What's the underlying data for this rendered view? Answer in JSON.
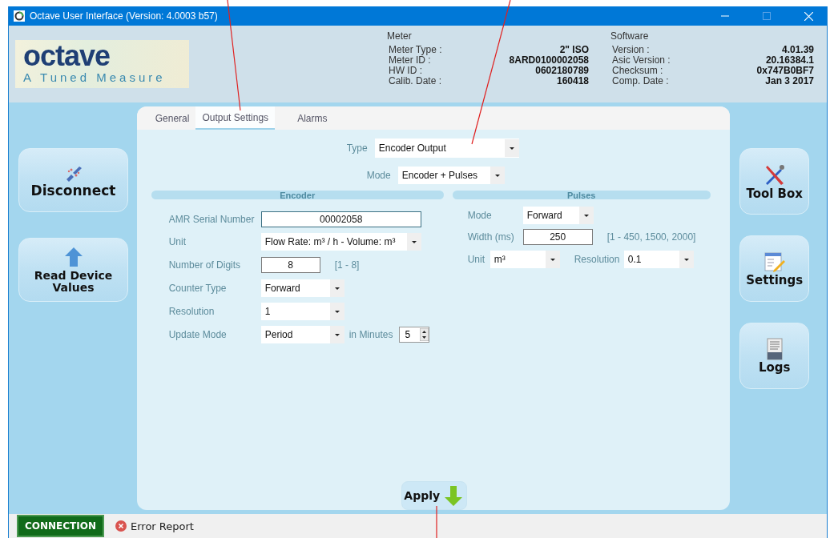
{
  "window": {
    "title": "Octave User Interface (Version: 4.0003 b57)"
  },
  "header": {
    "logo": {
      "name": "octave",
      "tagline": "A Tuned Measure"
    },
    "meter": {
      "heading": "Meter",
      "rows": [
        {
          "label": "Meter Type :",
          "value": "2\" ISO"
        },
        {
          "label": "Meter ID :",
          "value": "8ARD0100002058"
        },
        {
          "label": "HW ID :",
          "value": "0602180789"
        },
        {
          "label": "Calib. Date :",
          "value": "160418"
        }
      ]
    },
    "software": {
      "heading": "Software",
      "rows": [
        {
          "label": "Version :",
          "value": "4.01.39"
        },
        {
          "label": "Asic Version :",
          "value": "20.16384.1"
        },
        {
          "label": "Checksum :",
          "value": "0x747B0BF7"
        },
        {
          "label": "Comp. Date :",
          "value": "Jan 3 2017"
        }
      ]
    }
  },
  "left_buttons": [
    {
      "kind": "disconnect",
      "label": "Disconnect"
    },
    {
      "kind": "read",
      "label": "Read Device Values"
    }
  ],
  "right_buttons": [
    {
      "kind": "toolbox",
      "label": "Tool Box"
    },
    {
      "kind": "settings",
      "label": "Settings"
    },
    {
      "kind": "logs",
      "label": "Logs"
    }
  ],
  "tabs": [
    {
      "label": "General",
      "selected": false
    },
    {
      "label": "Output Settings",
      "selected": true
    },
    {
      "label": "Alarms",
      "selected": false
    }
  ],
  "output": {
    "type": {
      "label": "Type",
      "value": "Encoder Output"
    },
    "mode": {
      "label": "Mode",
      "value": "Encoder + Pulses"
    }
  },
  "encoder": {
    "heading": "Encoder",
    "rows": [
      {
        "fields": [
          {
            "kind": "text",
            "label": "AMR Serial Number",
            "value": "00002058"
          }
        ]
      },
      {
        "fields": [
          {
            "kind": "select",
            "label": "Unit",
            "value": "Flow Rate: m³ / h - Volume: m³"
          }
        ]
      },
      {
        "fields": [
          {
            "kind": "text",
            "label": "Number of Digits",
            "value": "8",
            "hint": "[1 - 8]"
          }
        ]
      },
      {
        "fields": [
          {
            "kind": "select",
            "label": "Counter Type",
            "value": "Forward"
          }
        ]
      },
      {
        "fields": [
          {
            "kind": "select",
            "label": "Resolution",
            "value": "1"
          }
        ]
      },
      {
        "fields": [
          {
            "kind": "select",
            "label": "Update Mode",
            "value": "Period"
          },
          {
            "kind": "spinner",
            "label": "in Minutes",
            "value": "5"
          }
        ]
      }
    ]
  },
  "pulses": {
    "heading": "Pulses",
    "rows": [
      {
        "fields": [
          {
            "kind": "select",
            "label": "Mode",
            "value": "Forward"
          }
        ]
      },
      {
        "fields": [
          {
            "kind": "text",
            "label": "Width (ms)",
            "value": "250",
            "hint": "[1 - 450, 1500, 2000]"
          }
        ]
      },
      {
        "fields": [
          {
            "kind": "select",
            "label": "Unit",
            "value": "m³"
          },
          {
            "kind": "select",
            "label": "Resolution",
            "value": "0.1"
          }
        ]
      }
    ]
  },
  "apply_button": {
    "label": "Apply"
  },
  "status_bar": {
    "connection": "CONNECTION",
    "error_report": "Error Report"
  }
}
